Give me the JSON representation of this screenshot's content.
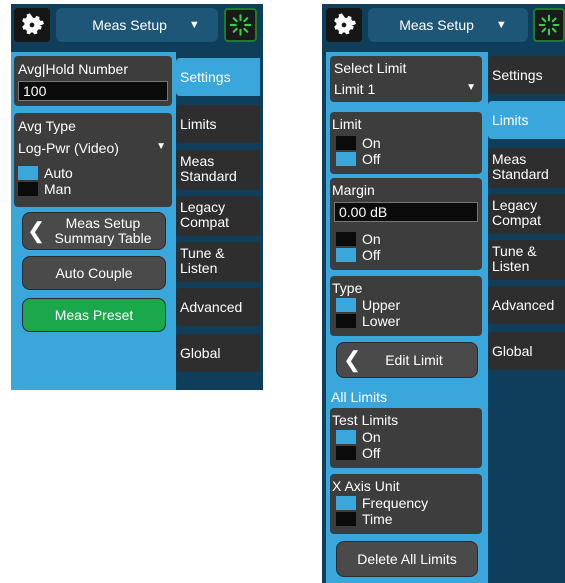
{
  "left": {
    "header_title": "Meas Setup",
    "avg_hold": {
      "label": "Avg|Hold Number",
      "value": "100"
    },
    "avg_type": {
      "label": "Avg Type",
      "value": "Log-Pwr (Video)",
      "opt_auto": "Auto",
      "opt_man": "Man"
    },
    "summary_btn": {
      "line1": "Meas Setup",
      "line2": "Summary Table"
    },
    "auto_couple": "Auto Couple",
    "meas_preset": "Meas Preset",
    "tabs": [
      {
        "line1": "Settings",
        "line2": ""
      },
      {
        "line1": "Limits",
        "line2": ""
      },
      {
        "line1": "Meas",
        "line2": "Standard"
      },
      {
        "line1": "Legacy",
        "line2": "Compat"
      },
      {
        "line1": "Tune &",
        "line2": "Listen"
      },
      {
        "line1": "Advanced",
        "line2": ""
      },
      {
        "line1": "Global",
        "line2": ""
      }
    ]
  },
  "right": {
    "header_title": "Meas Setup",
    "select_limit": {
      "label": "Select Limit",
      "value": "Limit 1"
    },
    "limit": {
      "label": "Limit",
      "on": "On",
      "off": "Off"
    },
    "margin": {
      "label": "Margin",
      "value": "0.00 dB",
      "on": "On",
      "off": "Off"
    },
    "type": {
      "label": "Type",
      "upper": "Upper",
      "lower": "Lower"
    },
    "edit_limit": "Edit Limit",
    "all_limits": "All Limits",
    "test_limits": {
      "label": "Test Limits",
      "on": "On",
      "off": "Off"
    },
    "x_axis_unit": {
      "label": "X Axis Unit",
      "freq": "Frequency",
      "time": "Time"
    },
    "delete_all": "Delete All Limits",
    "tabs": [
      {
        "line1": "Settings",
        "line2": ""
      },
      {
        "line1": "Limits",
        "line2": ""
      },
      {
        "line1": "Meas",
        "line2": "Standard"
      },
      {
        "line1": "Legacy",
        "line2": "Compat"
      },
      {
        "line1": "Tune &",
        "line2": "Listen"
      },
      {
        "line1": "Advanced",
        "line2": ""
      },
      {
        "line1": "Global",
        "line2": ""
      }
    ]
  },
  "colors": {
    "accent": "#3aa7dc",
    "panel": "#0f3e5a",
    "green": "#1aa84a"
  }
}
